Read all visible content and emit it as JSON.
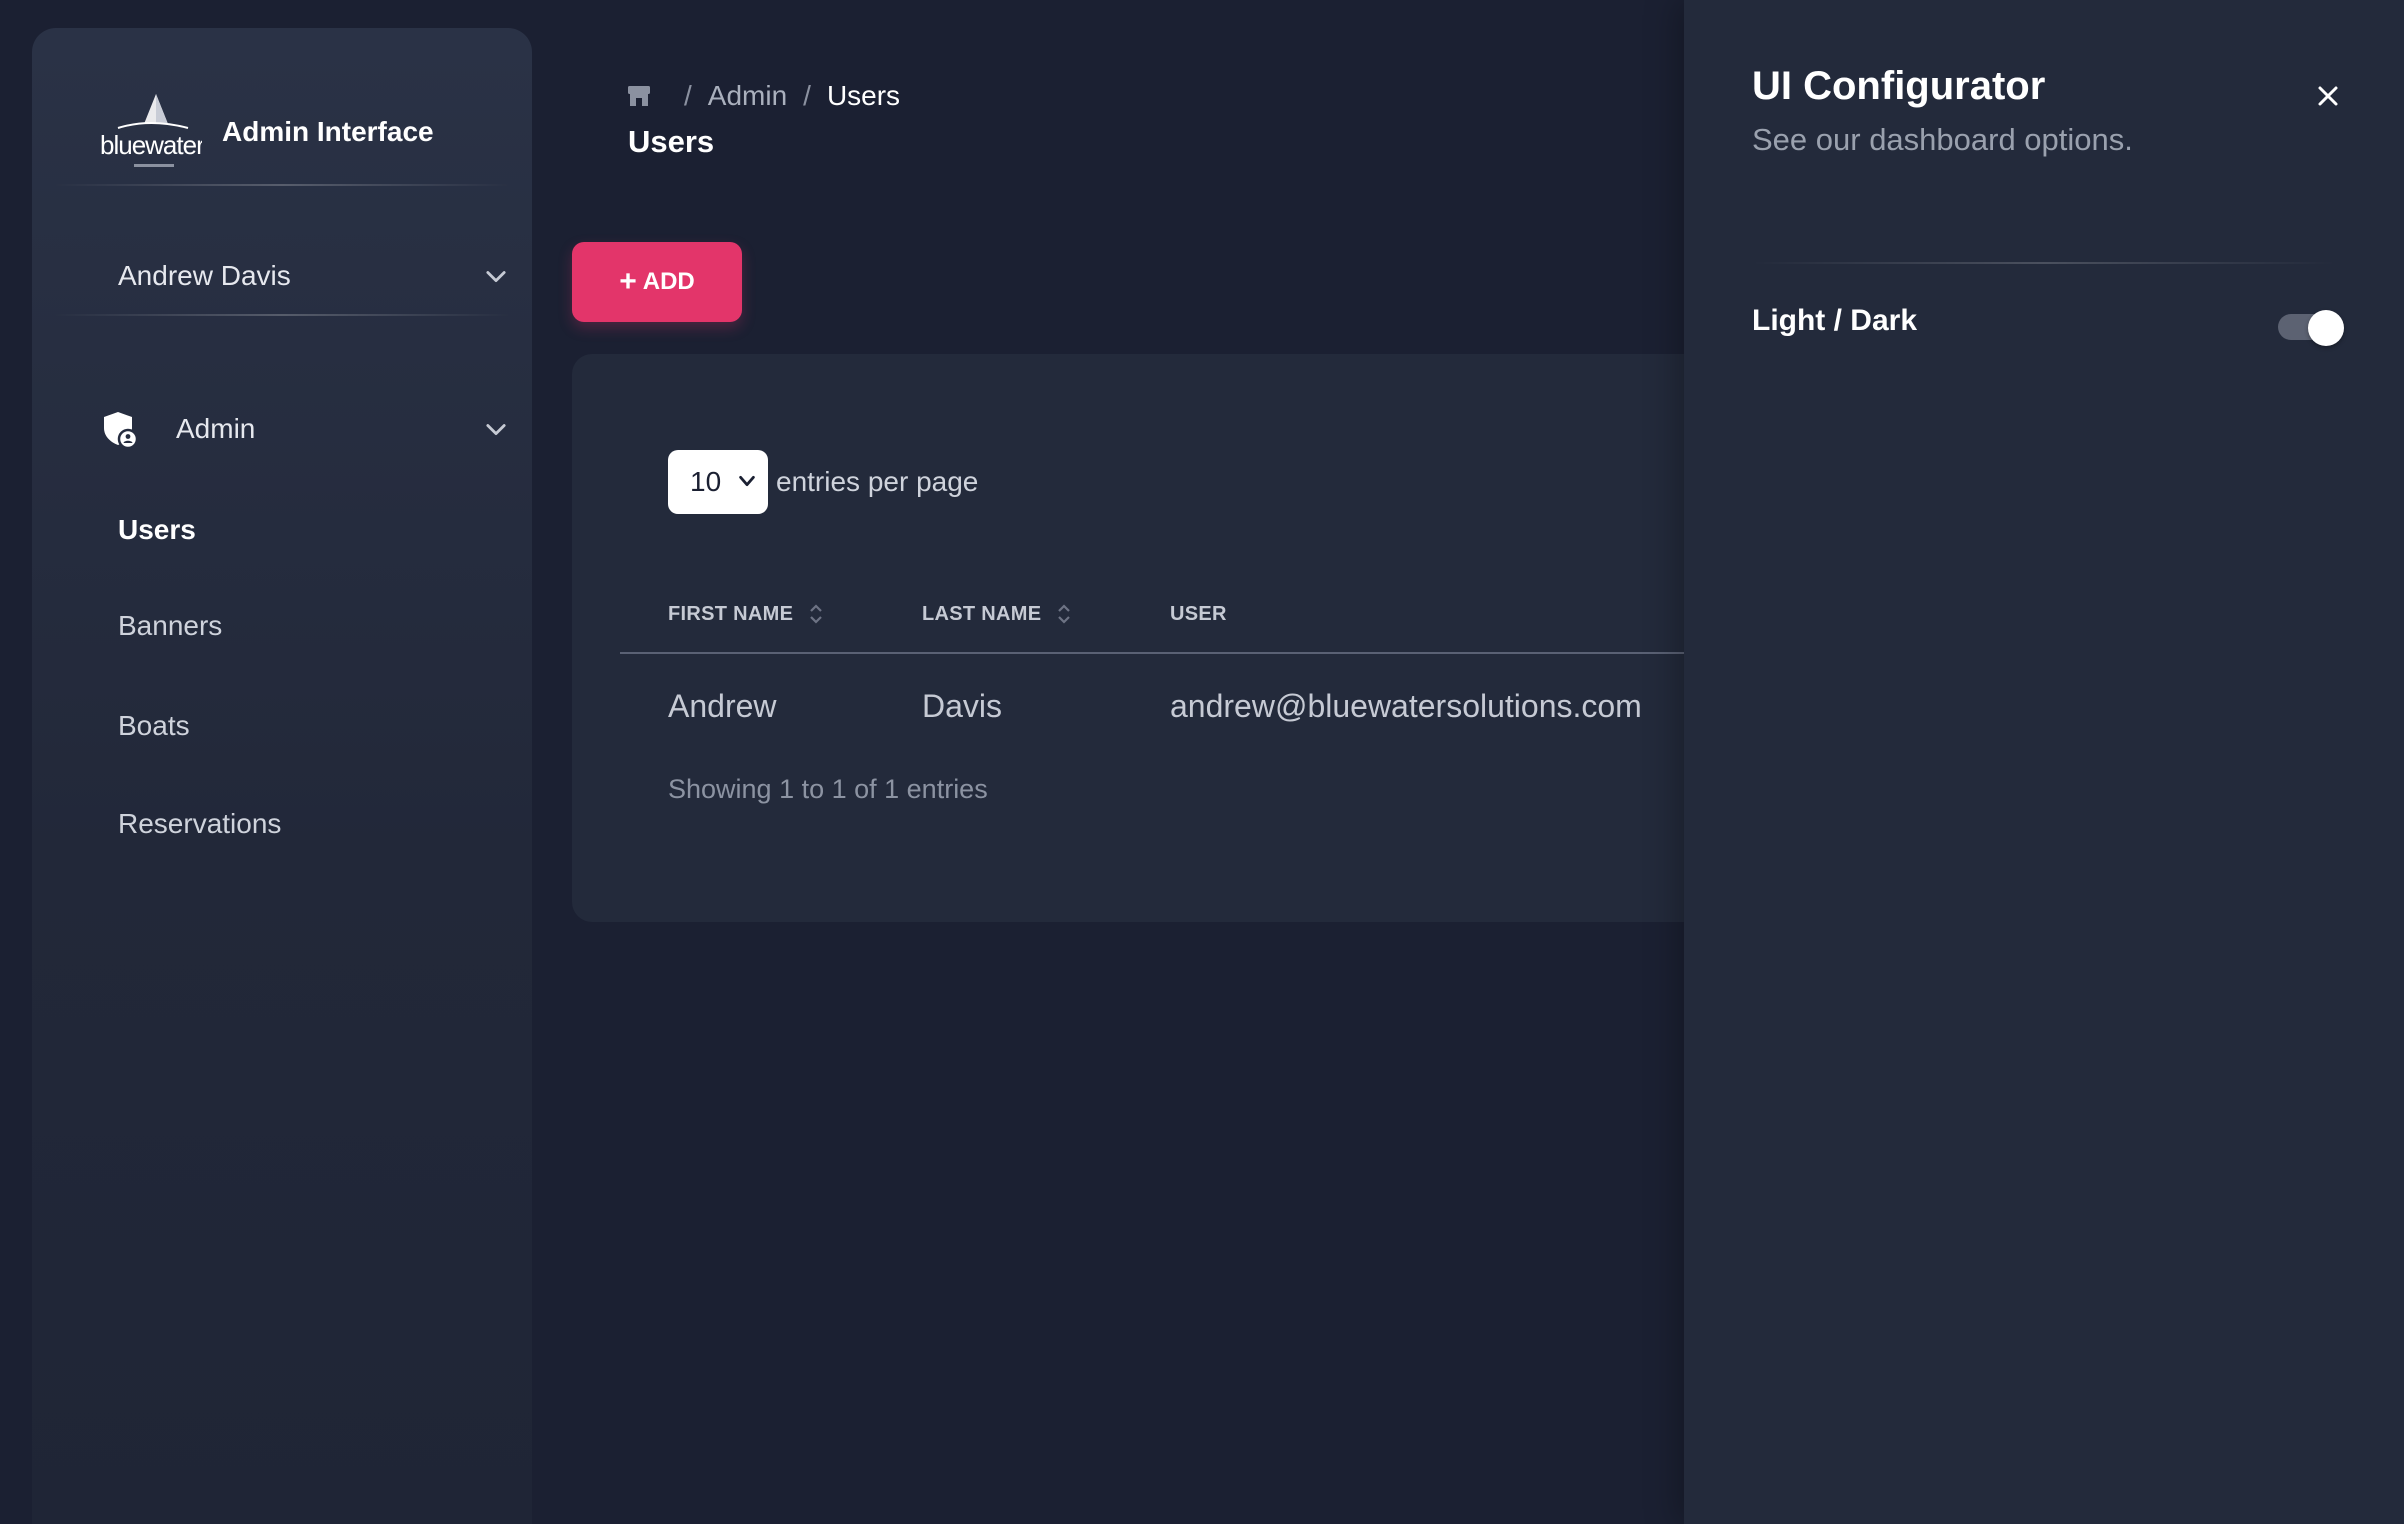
{
  "sidebar": {
    "brand_title": "Admin Interface",
    "user_name": "Andrew Davis",
    "section_label": "Admin",
    "items": [
      {
        "label": "Users",
        "active": true
      },
      {
        "label": "Banners",
        "active": false
      },
      {
        "label": "Boats",
        "active": false
      },
      {
        "label": "Reservations",
        "active": false
      }
    ]
  },
  "breadcrumb": {
    "home_icon": "home-icon",
    "sep": "/",
    "items": [
      "Admin",
      "Users"
    ]
  },
  "page": {
    "title": "Users",
    "add_label": "ADD"
  },
  "table": {
    "entries_value": "10",
    "entries_label": "entries per page",
    "columns": [
      "FIRST NAME",
      "LAST NAME",
      "USER"
    ],
    "rows": [
      {
        "first": "Andrew",
        "last": "Davis",
        "user": "andrew@bluewatersolutions.com"
      }
    ],
    "footer": "Showing 1 to 1 of 1 entries"
  },
  "config": {
    "title": "UI Configurator",
    "subtitle": "See our dashboard options.",
    "toggle_label": "Light / Dark",
    "toggle_on": true
  },
  "colors": {
    "background": "#1b2032",
    "panel": "#232a3b",
    "accent": "#e3356a"
  }
}
